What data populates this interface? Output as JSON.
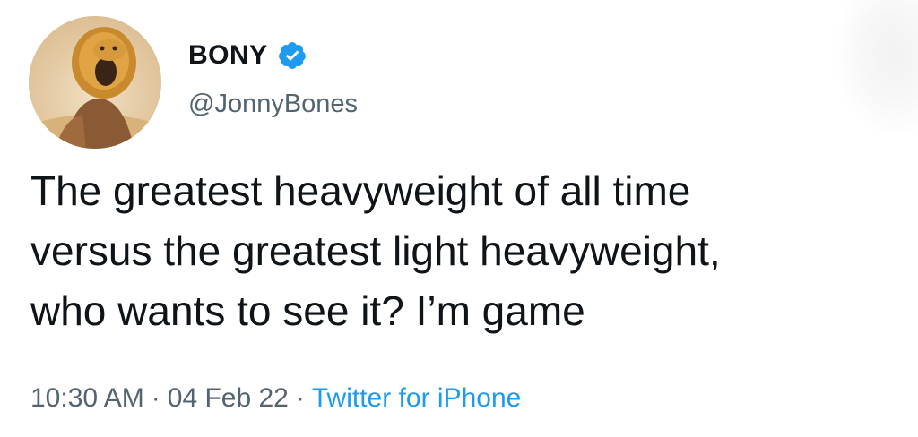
{
  "tweet": {
    "author": {
      "display_name": "BONY",
      "handle": "@JonnyBones",
      "verified_icon": "verified-badge-icon",
      "avatar_icon": "lion-headdress-avatar"
    },
    "text_lines": [
      "The greatest heavyweight of all time",
      "versus the greatest light heavyweight,",
      "who wants to see it? I’m game"
    ],
    "time": "10:30 AM",
    "separator": "·",
    "date": "04 Feb 22",
    "source": "Twitter for iPhone"
  },
  "colors": {
    "text": "#0f1419",
    "secondary": "#536471",
    "accent": "#1d9bf0"
  }
}
